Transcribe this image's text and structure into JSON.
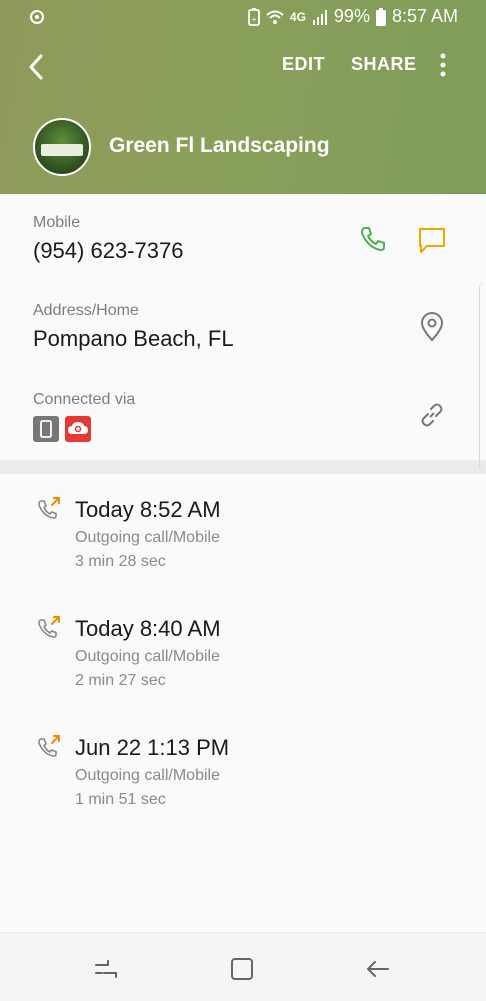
{
  "status": {
    "network": "4G",
    "battery": "99%",
    "time": "8:57 AM"
  },
  "appbar": {
    "edit_label": "EDIT",
    "share_label": "SHARE"
  },
  "contact": {
    "name": "Green Fl Landscaping",
    "phone_label": "Mobile",
    "phone_value": "(954) 623-7376",
    "address_label": "Address/Home",
    "address_value": "Pompano Beach, FL",
    "connected_label": "Connected via"
  },
  "call_log": [
    {
      "time": "Today 8:52 AM",
      "type": "Outgoing call/Mobile",
      "duration": "3 min 28 sec"
    },
    {
      "time": "Today 8:40 AM",
      "type": "Outgoing call/Mobile",
      "duration": "2 min 27 sec"
    },
    {
      "time": "Jun 22 1:13 PM",
      "type": "Outgoing call/Mobile",
      "duration": "1 min 51 sec"
    }
  ],
  "colors": {
    "header_bg": "#8a9d5a",
    "call_icon": "#4caf50",
    "message_icon": "#f0a500",
    "outgoing_arrow": "#f08a00",
    "cloud_badge": "#e53935"
  },
  "icons": {
    "back": "back-arrow-icon",
    "more": "more-vert-icon",
    "call": "phone-icon",
    "message": "message-icon",
    "location": "location-pin-icon",
    "link": "link-icon",
    "device": "device-icon",
    "cloud": "cloud-sync-icon",
    "outgoing": "outgoing-call-icon"
  }
}
